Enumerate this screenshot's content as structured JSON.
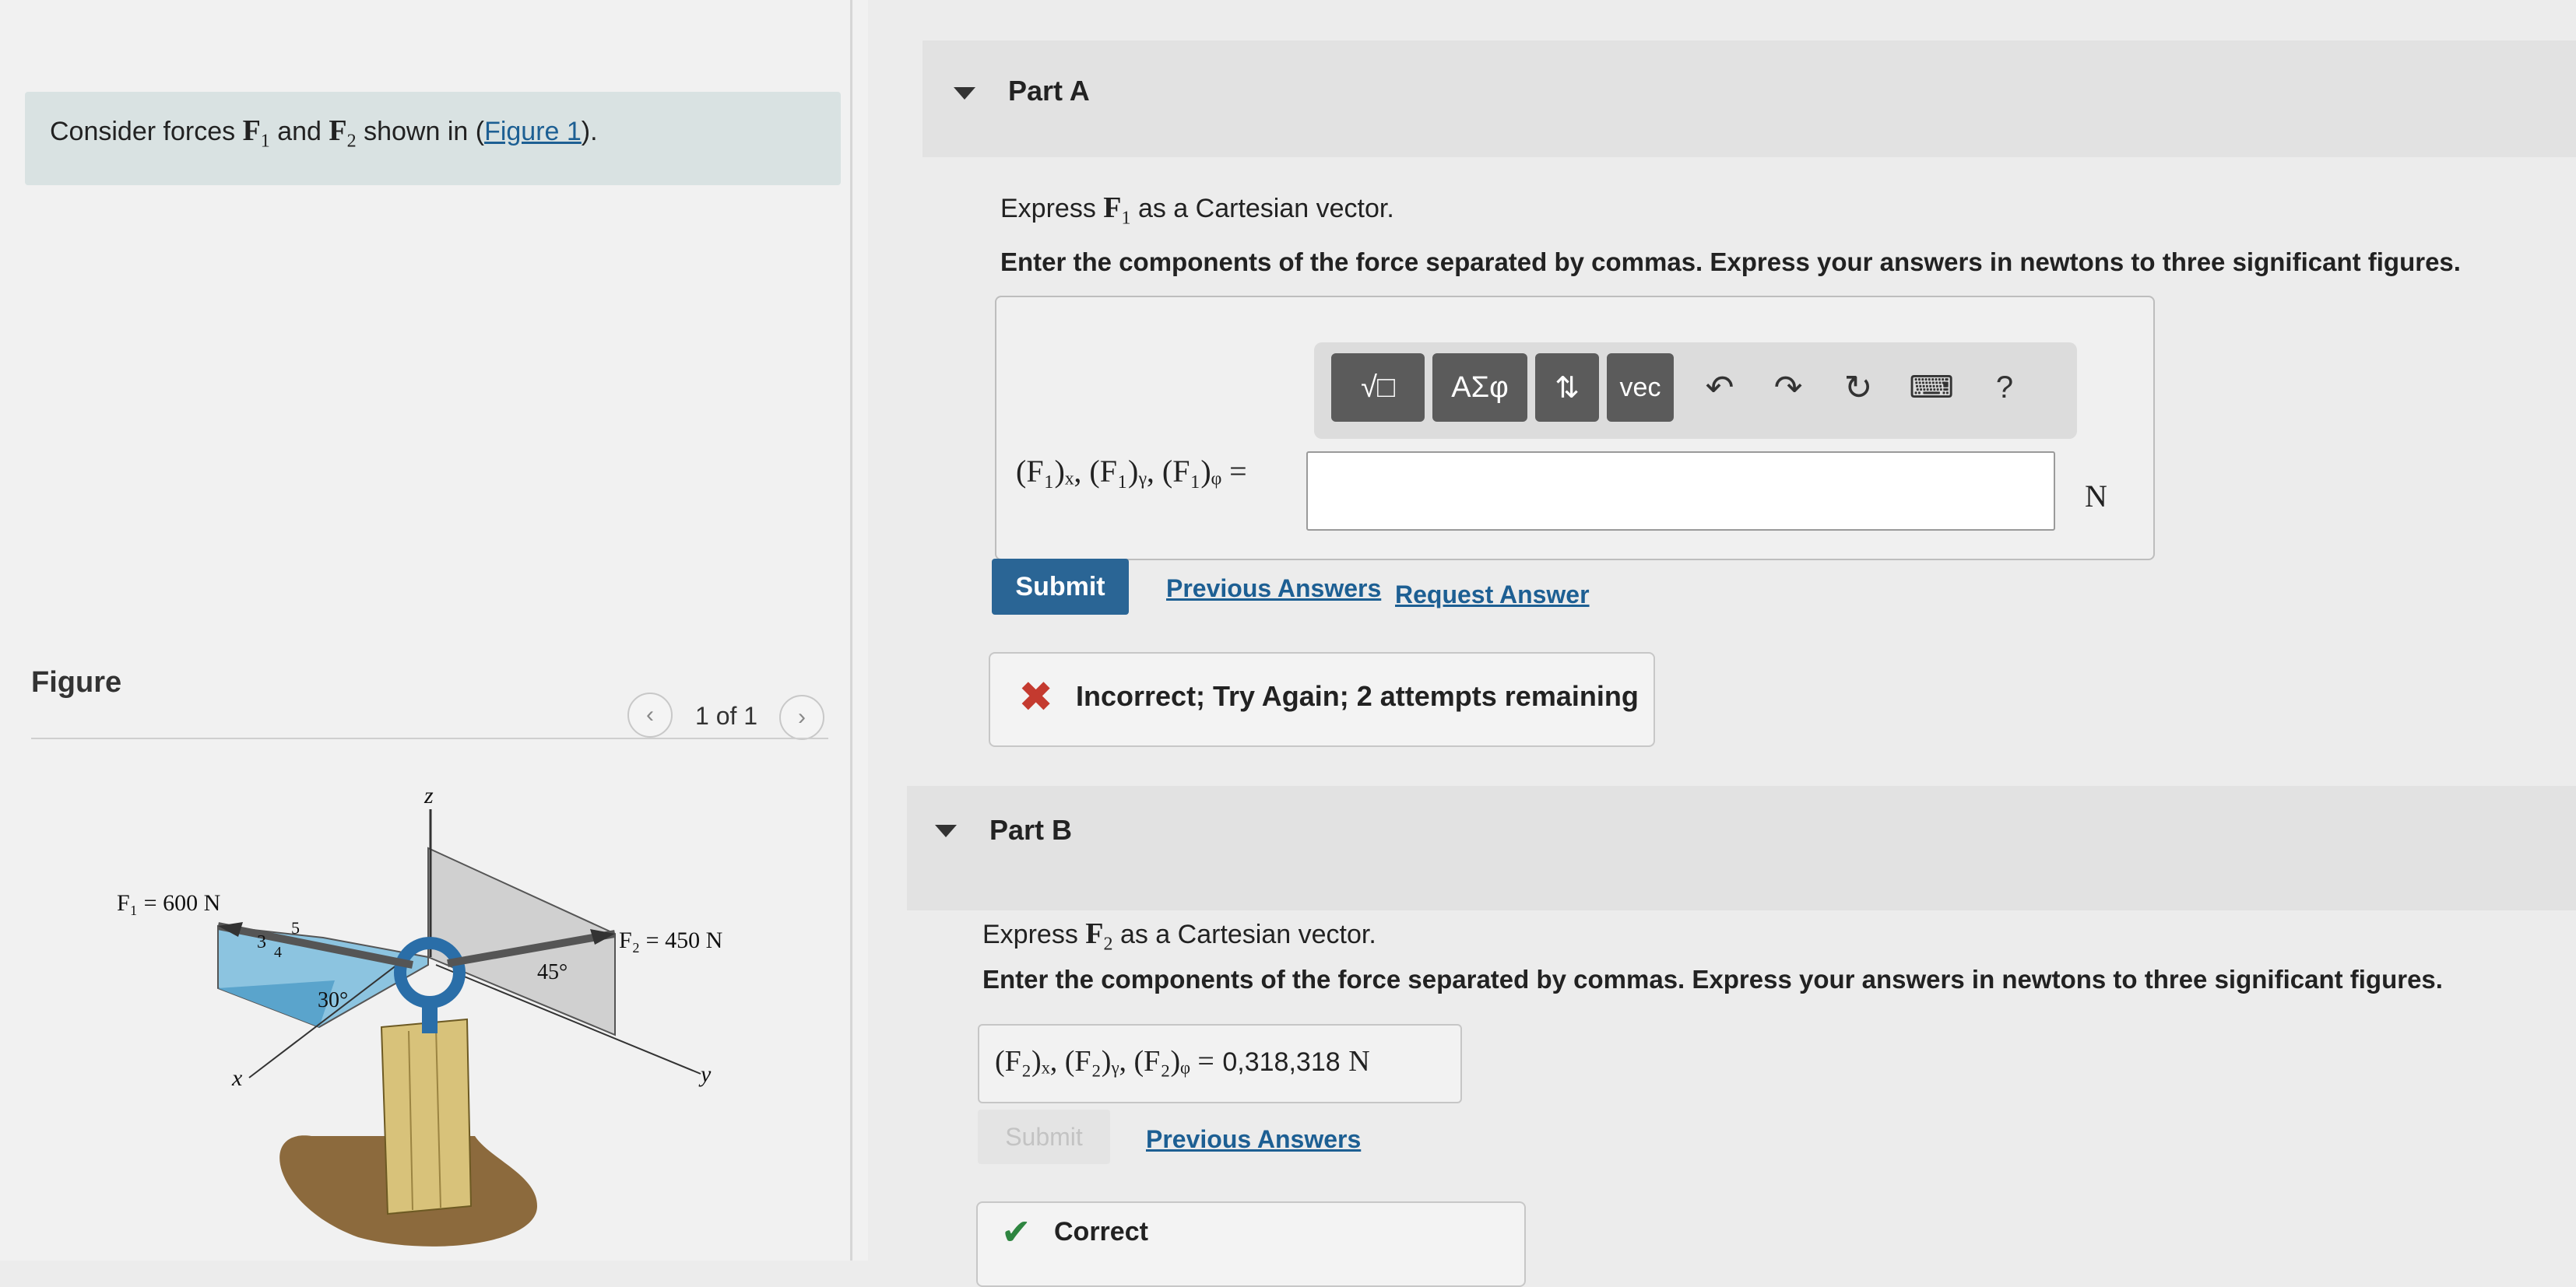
{
  "problem": {
    "prompt_before": "Consider forces",
    "f1_symbol": "F",
    "f1_sub": "1",
    "and_text": "and",
    "f2_symbol": "F",
    "f2_sub": "2",
    "shown_in": "shown in (",
    "figure_link": "Figure 1",
    "prompt_after": ")."
  },
  "figure": {
    "title": "Figure",
    "counter": "1 of 1",
    "prev_icon": "chevron-left-icon",
    "next_icon": "chevron-right-icon",
    "f1_label": "F₁ = 600 N",
    "f2_label": "F₂ = 450 N",
    "angle_45": "45°",
    "angle_30": "30°",
    "ratio_3": "3",
    "ratio_4": "4",
    "ratio_5": "5",
    "axis_z": "z",
    "axis_x": "x",
    "axis_y": "y"
  },
  "part_a": {
    "title": "Part A",
    "question_before": "Express",
    "question_vector": "F",
    "question_sub": "1",
    "question_after": "as a Cartesian vector.",
    "instructions": "Enter the components of the force separated by commas. Express your answers in newtons to three significant figures.",
    "toolbar": {
      "templates": "√□",
      "greek": "ΑΣφ",
      "arrows": "⇅",
      "vec": "vec",
      "help": "?"
    },
    "answer_label": "(F₁)ₓ, (F₁)ᵧ, (F₁)ᵩ =",
    "answer_value": "",
    "unit": "N",
    "submit": "Submit",
    "previous_answers": "Previous Answers",
    "request_answer": "Request Answer",
    "feedback": "Incorrect; Try Again; 2 attempts remaining"
  },
  "part_b": {
    "title": "Part B",
    "question_before": "Express",
    "question_vector": "F",
    "question_sub": "2",
    "question_after": "as a Cartesian vector.",
    "instructions": "Enter the components of the force separated by commas. Express your answers in newtons to three significant figures.",
    "answer_label": "(F₂)ₓ, (F₂)ᵧ, (F₂)ᵩ =",
    "answer_value": "0,318,318",
    "unit": "N",
    "submit": "Submit",
    "previous_answers": "Previous Answers",
    "feedback": "Correct"
  },
  "colors": {
    "link": "#1d5f93",
    "submit_bg": "#2a6595",
    "incorrect": "#c43a2f",
    "correct": "#2e8540"
  }
}
